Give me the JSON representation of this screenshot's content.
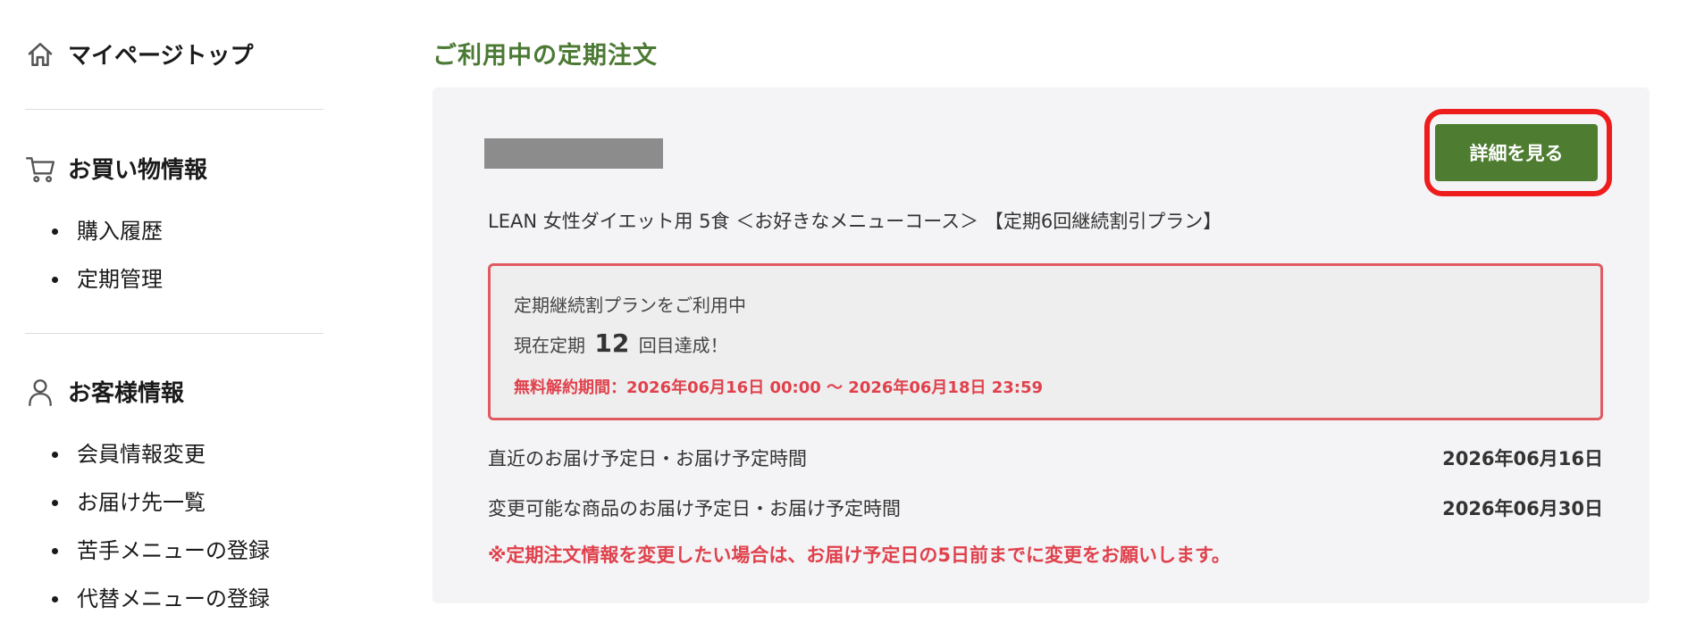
{
  "sidebar": {
    "mypage_top": {
      "label": "マイページトップ",
      "icon": "home-icon"
    },
    "shopping": {
      "heading": "お買い物情報",
      "icon": "cart-icon",
      "items": [
        {
          "label": "購入履歴"
        },
        {
          "label": "定期管理"
        }
      ]
    },
    "customer": {
      "heading": "お客様情報",
      "icon": "user-icon",
      "items": [
        {
          "label": "会員情報変更"
        },
        {
          "label": "お届け先一覧"
        },
        {
          "label": "苦手メニューの登録"
        },
        {
          "label": "代替メニューの登録"
        }
      ]
    }
  },
  "main": {
    "title": "ご利用中の定期注文",
    "order": {
      "detail_button": "詳細を見る",
      "product_name": "LEAN 女性ダイエット用 5食 ＜お好きなメニューコース＞ 【定期6回継続割引プラン】",
      "plan_status": "定期継続割プランをご利用中",
      "count_prefix": "現在定期",
      "count_value": "12",
      "count_suffix": "回目達成！",
      "cancel_period": "無料解約期間：2026年06月16日 00:00 〜 2026年06月18日 23:59",
      "next_delivery_label": "直近のお届け予定日・お届け予定時間",
      "next_delivery_value": "2026年06月16日",
      "changeable_label": "変更可能な商品のお届け予定日・お届け予定時間",
      "changeable_value": "2026年06月30日",
      "warning": "※定期注文情報を変更したい場合は、お届け予定日の5日前までに変更をお願いします。"
    }
  },
  "colors": {
    "accent_green": "#4e7d31",
    "title_green": "#4c7a34",
    "alert_red": "#e0414c",
    "highlight_red": "#ee1c1c",
    "panel_bg": "#f4f4f6"
  }
}
